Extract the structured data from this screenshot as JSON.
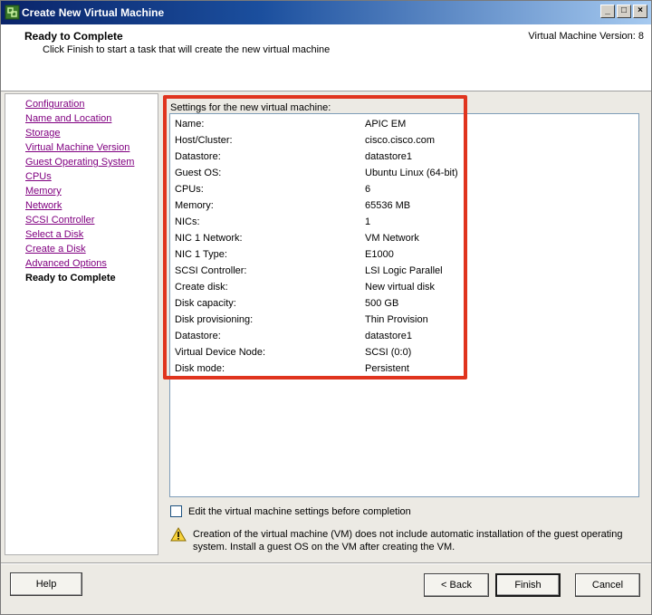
{
  "window": {
    "title": "Create New Virtual Machine",
    "minimize": "_",
    "maximize": "□",
    "close": "×"
  },
  "header": {
    "title": "Ready to Complete",
    "subtitle": "Click Finish to start a task that will create the new virtual machine",
    "version": "Virtual Machine Version: 8"
  },
  "nav": {
    "items": [
      {
        "label": "Configuration"
      },
      {
        "label": "Name and Location"
      },
      {
        "label": "Storage"
      },
      {
        "label": "Virtual Machine Version"
      },
      {
        "label": "Guest Operating System"
      },
      {
        "label": "CPUs"
      },
      {
        "label": "Memory"
      },
      {
        "label": "Network"
      },
      {
        "label": "SCSI Controller"
      },
      {
        "label": "Select a Disk"
      },
      {
        "label": "Create a Disk"
      },
      {
        "label": "Advanced Options"
      },
      {
        "label": "Ready to Complete"
      }
    ]
  },
  "settings": {
    "heading": "Settings for the new virtual machine:",
    "rows": [
      {
        "key": "Name:",
        "value": "APIC EM"
      },
      {
        "key": "Host/Cluster:",
        "value": "cisco.cisco.com"
      },
      {
        "key": "Datastore:",
        "value": "datastore1"
      },
      {
        "key": "Guest OS:",
        "value": "Ubuntu Linux (64-bit)"
      },
      {
        "key": "CPUs:",
        "value": "6"
      },
      {
        "key": "Memory:",
        "value": "65536 MB"
      },
      {
        "key": "NICs:",
        "value": "1"
      },
      {
        "key": "NIC 1 Network:",
        "value": "VM Network"
      },
      {
        "key": "NIC 1 Type:",
        "value": "E1000"
      },
      {
        "key": "SCSI Controller:",
        "value": "LSI Logic Parallel"
      },
      {
        "key": "Create disk:",
        "value": "New virtual disk"
      },
      {
        "key": "Disk capacity:",
        "value": "500 GB"
      },
      {
        "key": "Disk provisioning:",
        "value": "Thin Provision"
      },
      {
        "key": "Datastore:",
        "value": "datastore1"
      },
      {
        "key": "Virtual Device Node:",
        "value": "SCSI (0:0)"
      },
      {
        "key": "Disk mode:",
        "value": "Persistent"
      }
    ]
  },
  "edit_checkbox": {
    "label": "Edit the virtual machine settings before completion",
    "checked": false
  },
  "warning": {
    "icon": "warning-icon",
    "text": "Creation of the virtual machine (VM) does not include automatic installation of the guest operating system. Install a guest OS on the VM after creating the VM."
  },
  "buttons": {
    "help": "Help",
    "back": "< Back",
    "finish": "Finish",
    "cancel": "Cancel"
  },
  "colors": {
    "highlight": "#e0341e",
    "link_visited": "#800080"
  }
}
